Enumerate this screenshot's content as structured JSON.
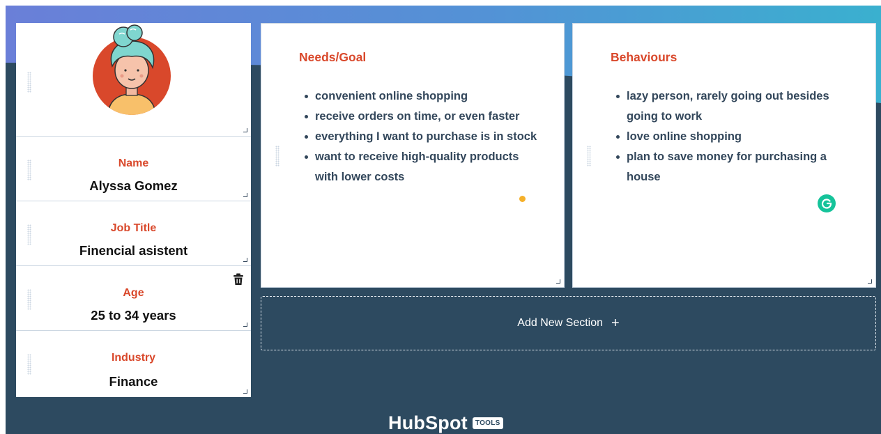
{
  "persona": {
    "fields": [
      {
        "label": "Name",
        "value": "Alyssa Gomez"
      },
      {
        "label": "Job Title",
        "value": "Finencial asistent"
      },
      {
        "label": "Age",
        "value": "25 to 34 years"
      },
      {
        "label": "Industry",
        "value": "Finance"
      }
    ]
  },
  "sections": [
    {
      "title": "Needs/Goal",
      "items": [
        "convenient online shopping",
        "receive orders on time, or even faster",
        "everything I want to purchase is in stock",
        "want to receive high-quality products with lower costs"
      ]
    },
    {
      "title": "Behaviours",
      "items": [
        "lazy person, rarely going out besides going to work",
        "love online shopping",
        "plan to save money for purchasing a house"
      ]
    }
  ],
  "add_section": {
    "label": "Add New Section",
    "icon": "plus-icon"
  },
  "footer": {
    "logo_text": "HubSpot",
    "badge": "TOOLS"
  },
  "colors": {
    "background": "#2d4a60",
    "gradient_left": "#6a7fd8",
    "gradient_right": "#3ab0cf",
    "label": "#d9482b",
    "avatar_bg": "#d9482b",
    "avatar_hair": "#7fd6cf",
    "avatar_shirt": "#f8c06a",
    "grammarly": "#15c39a"
  }
}
